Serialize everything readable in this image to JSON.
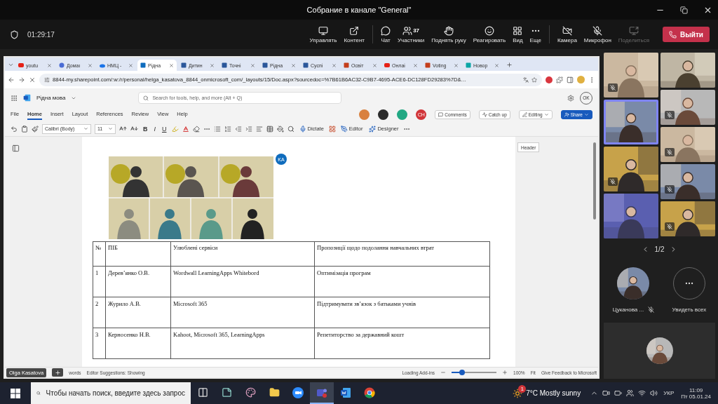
{
  "window": {
    "title": "Собрание в канале \"General\""
  },
  "meeting_bar": {
    "timer": "01:29:17",
    "participants_count": "37",
    "leave": "Выйти",
    "actions": [
      {
        "kind": "manage",
        "label": "Управлять",
        "disabled": false
      },
      {
        "kind": "content",
        "label": "Контент",
        "disabled": false
      },
      {
        "kind": "chat",
        "label": "Чат",
        "disabled": false
      },
      {
        "kind": "people",
        "label": "Участники",
        "disabled": false
      },
      {
        "kind": "hand",
        "label": "Поднять руку",
        "disabled": false
      },
      {
        "kind": "react",
        "label": "Реагировать",
        "disabled": false
      },
      {
        "kind": "view",
        "label": "Вид",
        "disabled": false
      },
      {
        "kind": "more",
        "label": "Еще",
        "disabled": false
      },
      {
        "kind": "camera",
        "label": "Камера",
        "disabled": false
      },
      {
        "kind": "mic",
        "label": "Микрофон",
        "disabled": false
      },
      {
        "kind": "share",
        "label": "Поделиться",
        "disabled": true
      }
    ]
  },
  "browser": {
    "tabs": [
      {
        "kind": "youtube",
        "label": "youtu",
        "selected": false
      },
      {
        "kind": "site",
        "label": "Домаı",
        "selected": false
      },
      {
        "kind": "cloud",
        "label": "НМЦ -",
        "selected": false
      },
      {
        "kind": "sway",
        "label": "Рідна",
        "selected": true
      },
      {
        "kind": "word",
        "label": "Дитин",
        "selected": false
      },
      {
        "kind": "word",
        "label": "Точні",
        "selected": false
      },
      {
        "kind": "word",
        "label": "Рідна",
        "selected": false
      },
      {
        "kind": "word",
        "label": "Суспі",
        "selected": false
      },
      {
        "kind": "forms",
        "label": "Освіт",
        "selected": false
      },
      {
        "kind": "youtube",
        "label": "Онлаі",
        "selected": false
      },
      {
        "kind": "forms",
        "label": "Voting",
        "selected": false
      },
      {
        "kind": "teal",
        "label": "Новор",
        "selected": false
      }
    ],
    "url": "8844-my.sharepoint.com/:w:/r/personal/helga_kasatova_8844_onmicrosoft_com/_layouts/15/Doc.aspx?sourcedoc=%7B61B6AC32-C9B7-4695-ACE6-DC128FD29283%7D&…"
  },
  "word": {
    "doc_title": "Рідна мова",
    "search": {
      "placeholder": "Search for tools, help, and more (Alt + Q)"
    },
    "account": "OK",
    "ribbon_tabs": [
      {
        "label": "File",
        "selected": false
      },
      {
        "label": "Home",
        "selected": true
      },
      {
        "label": "Insert",
        "selected": false
      },
      {
        "label": "Layout",
        "selected": false
      },
      {
        "label": "References",
        "selected": false
      },
      {
        "label": "Review",
        "selected": false
      },
      {
        "label": "View",
        "selected": false
      },
      {
        "label": "Help",
        "selected": false
      }
    ],
    "collaborators": [
      {
        "color": "#d9813f"
      },
      {
        "color": "#2b2b2b"
      },
      {
        "color": "#21a883"
      },
      {
        "color": "#d13438",
        "initials": "CH"
      }
    ],
    "actions": {
      "comments": "Comments",
      "catch_up": "Catch up",
      "editing": "Editing",
      "share": "Share"
    },
    "toolbar": {
      "font": "Calibri (Body)",
      "size": "11",
      "format_letters": [
        "B",
        "I",
        "U"
      ],
      "dictate": "Dictate",
      "editor": "Editor",
      "designer": "Designer"
    },
    "document": {
      "comment_marker": "KA",
      "header_tag": "Header",
      "table": {
        "columns": [
          "№",
          "ПІБ",
          "Улюблені сервіси",
          "Пропозиції щодо подолання навчальних втрат"
        ],
        "rows": [
          [
            "1",
            "Дерев’янко О.В.",
            "Wordwall   LearningApps Whitebord",
            "Оптимізація програм"
          ],
          [
            "2",
            "Журило А.В.",
            "Microsoft 365",
            "Підтримувати зв’язок з батьками учнів"
          ],
          [
            "3",
            "Керносенко Н.В.",
            "Kahoot, Microsoft 365, LearningApps",
            "Репетиторство за державний кошт"
          ]
        ]
      }
    },
    "status_bar": {
      "words": "words",
      "editor_suggestions": "Editor Suggestions: Showing",
      "add_ins": "Loading Add-ins",
      "zoom_slider": {
        "level": 0.24
      },
      "zoom": "100%",
      "fit": "Fit",
      "feedback": "Give Feedback to Microsoft"
    }
  },
  "shared_screen": {
    "presenter": "Olga Kasatova"
  },
  "participants": {
    "columns": [
      {
        "tiles": [
          {
            "muted": true,
            "speaking": false
          },
          {
            "muted": false,
            "speaking": true
          },
          {
            "muted": true,
            "speaking": false
          },
          {
            "muted": false,
            "speaking": false
          }
        ]
      },
      {
        "tiles": [
          {
            "muted": false,
            "speaking": false
          },
          {
            "muted": true,
            "speaking": false
          },
          {
            "muted": true,
            "speaking": false
          },
          {
            "muted": true,
            "speaking": false
          },
          {
            "muted": true,
            "speaking": false
          }
        ]
      }
    ],
    "pager": "1/2",
    "featured": {
      "name": "Цуканова ...",
      "muted": true
    },
    "see_all": "Увидеть всех"
  },
  "taskbar": {
    "search": {
      "placeholder": "Чтобы начать поиск, введите здесь запрос"
    },
    "apps": [
      {
        "kind": "taskview",
        "selected": false
      },
      {
        "kind": "notes",
        "selected": false
      },
      {
        "kind": "paint",
        "selected": false
      },
      {
        "kind": "explorer",
        "selected": false
      },
      {
        "kind": "zoom",
        "selected": false
      },
      {
        "kind": "teams",
        "selected": true
      },
      {
        "kind": "word",
        "selected": false
      },
      {
        "kind": "chrome",
        "selected": false
      }
    ],
    "weather": {
      "badge": "1",
      "text": "7°C Mostly sunny"
    },
    "language": "УКР",
    "time": "11:09",
    "date": "Пт 05.01.24"
  }
}
